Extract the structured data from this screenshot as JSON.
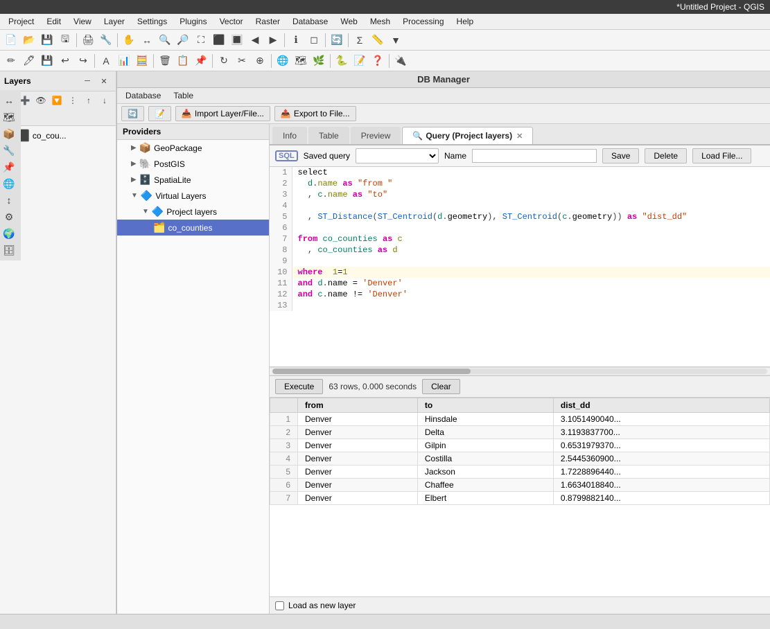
{
  "window": {
    "title": "*Untitled Project - QGIS"
  },
  "menu": {
    "items": [
      "Project",
      "Edit",
      "View",
      "Layer",
      "Settings",
      "Plugins",
      "Vector",
      "Raster",
      "Database",
      "Web",
      "Mesh",
      "Processing",
      "Help"
    ]
  },
  "layers_panel": {
    "title": "Layers",
    "layers": [
      {
        "label": "co_cou...",
        "checked": true
      }
    ]
  },
  "providers": {
    "title": "Providers",
    "items": [
      {
        "label": "GeoPackage",
        "level": 1,
        "expanded": false,
        "icon": "📦"
      },
      {
        "label": "PostGIS",
        "level": 1,
        "expanded": false,
        "icon": "🐘"
      },
      {
        "label": "SpatiaLite",
        "level": 1,
        "expanded": false,
        "icon": "🗄️"
      },
      {
        "label": "Virtual Layers",
        "level": 1,
        "expanded": true,
        "icon": "🔷"
      },
      {
        "label": "Project layers",
        "level": 2,
        "expanded": true,
        "icon": "📁"
      },
      {
        "label": "co_counties",
        "level": 3,
        "expanded": false,
        "icon": "🗂️",
        "selected": true
      }
    ]
  },
  "db_manager": {
    "title": "DB Manager",
    "menu": [
      "Database",
      "Table"
    ],
    "toolbar": [
      {
        "label": "Import Layer/File...",
        "icon": "📥"
      },
      {
        "label": "Export to File...",
        "icon": "📤"
      }
    ]
  },
  "tabs": [
    {
      "label": "Info",
      "active": false
    },
    {
      "label": "Table",
      "active": false
    },
    {
      "label": "Preview",
      "active": false
    },
    {
      "label": "Query (Project layers)",
      "active": true,
      "closeable": true
    }
  ],
  "sql_controls": {
    "sql_icon": "SQL",
    "saved_query_label": "Saved query",
    "name_label": "Name",
    "save_btn": "Save",
    "delete_btn": "Delete",
    "load_file_btn": "Load File..."
  },
  "code_lines": [
    {
      "num": 1,
      "code": "select",
      "tokens": [
        {
          "type": "kw",
          "text": "select"
        }
      ]
    },
    {
      "num": 2,
      "code": "  d.name as \"from \"",
      "html": "  <span class='tbl'>d</span><span class='punc'>.</span><span class='alias'>name</span> <span class='kw'>as</span> <span class='str'>\"from \"</span>"
    },
    {
      "num": 3,
      "code": "  , c.name as \"to\"",
      "html": "  <span class='punc'>, </span><span class='tbl'>c</span><span class='punc'>.</span><span class='alias'>name</span> <span class='kw'>as</span> <span class='str'>\"to\"</span>"
    },
    {
      "num": 4,
      "code": "",
      "html": ""
    },
    {
      "num": 5,
      "code": "  , ST_Distance(ST_Centroid(d.geometry), ST_Centroid(c.geometry)) as \"dist_dd\"",
      "html": "  <span class='punc'>, </span><span class='fn'>ST_Distance</span><span class='punc'>(</span><span class='fn'>ST_Centroid</span><span class='punc'>(</span><span class='tbl'>d</span><span class='punc'>.</span>geometry<span class='punc'>), </span><span class='fn'>ST_Centroid</span><span class='punc'>(</span><span class='tbl'>c</span><span class='punc'>.</span>geometry<span class='punc'>))</span> <span class='kw'>as</span> <span class='str'>\"dist_dd\"</span>"
    },
    {
      "num": 6,
      "code": "",
      "html": ""
    },
    {
      "num": 7,
      "code": "from co_counties as c",
      "html": "<span class='kw'>from</span> <span class='tbl'>co_counties</span> <span class='kw'>as</span> <span class='alias'>c</span>"
    },
    {
      "num": 8,
      "code": "  , co_counties as d",
      "html": "  <span class='punc'>, </span><span class='tbl'>co_counties</span> <span class='kw'>as</span> <span class='alias'>d</span>"
    },
    {
      "num": 9,
      "code": "",
      "html": ""
    },
    {
      "num": 10,
      "code": "where  1=1",
      "html": "<span class='kw'>where</span>  <span class='alias'>1</span>=<span class='alias'>1</span>",
      "current": true
    },
    {
      "num": 11,
      "code": "and d.name = 'Denver'",
      "html": "<span class='kw'>and</span> <span class='tbl'>d</span><span class='punc'>.</span>name = <span class='str'>'Denver'</span>"
    },
    {
      "num": 12,
      "code": "and c.name != 'Denver'",
      "html": "<span class='kw'>and</span> <span class='tbl'>c</span><span class='punc'>.</span>name != <span class='str'>'Denver'</span>"
    },
    {
      "num": 13,
      "code": "",
      "html": ""
    }
  ],
  "results": {
    "execute_btn": "Execute",
    "stats": "63 rows, 0.000 seconds",
    "clear_btn": "Clear",
    "columns": [
      "",
      "from",
      "to",
      "dist_dd"
    ],
    "rows": [
      {
        "num": 1,
        "from": "Denver",
        "to": "Hinsdale",
        "dist_dd": "3.1051490040..."
      },
      {
        "num": 2,
        "from": "Denver",
        "to": "Delta",
        "dist_dd": "3.1193837700..."
      },
      {
        "num": 3,
        "from": "Denver",
        "to": "Gilpin",
        "dist_dd": "0.6531979370..."
      },
      {
        "num": 4,
        "from": "Denver",
        "to": "Costilla",
        "dist_dd": "2.5445360900..."
      },
      {
        "num": 5,
        "from": "Denver",
        "to": "Jackson",
        "dist_dd": "1.7228896440..."
      },
      {
        "num": 6,
        "from": "Denver",
        "to": "Chaffee",
        "dist_dd": "1.6634018840..."
      },
      {
        "num": 7,
        "from": "Denver",
        "to": "Elbert",
        "dist_dd": "0.8799882140..."
      }
    ]
  },
  "load_layer": {
    "label": "Load as new layer"
  }
}
